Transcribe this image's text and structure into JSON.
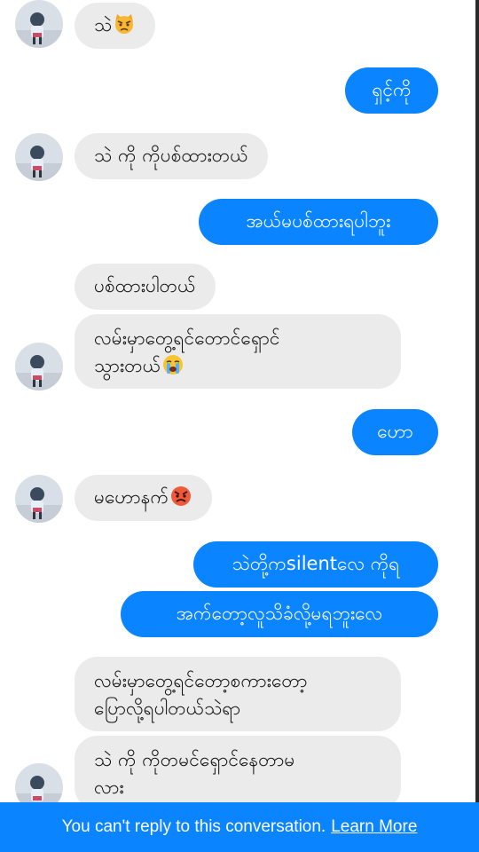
{
  "thread": {
    "messages": [
      {
        "text": "သဲ",
        "emoji": "pouting-cat-emoji"
      },
      {
        "text": "ရှင့်ကို"
      },
      {
        "text": "သဲ ကို ကိုပစ်ထားတယ်"
      },
      {
        "text": "အယ်မပစ်ထားရပါဘူး"
      },
      {
        "text": "ပစ်ထားပါတယ်"
      },
      {
        "line1": "လမ်းမှာတွေ့ရင်တောင်ရှောင်",
        "line2": "သွားတယ်",
        "emoji": "crying-face-emoji"
      },
      {
        "text": "ဟော"
      },
      {
        "text": "မဟောနက်",
        "emoji": "angry-face-emoji"
      },
      {
        "text": "သဲတို့ကsilentလေ ကိုရ"
      },
      {
        "text": "အက်တော့လူသိခံလို့မရဘူးလေ"
      },
      {
        "line1": "လမ်းမှာတွေ့ရင်တော့စကားတော့",
        "line2": "ပြောလို့ရပါတယ်သဲရာ"
      },
      {
        "line1": "သဲ ကို ကိုတမင်ရှောင်နေတာမ",
        "line2": "လား"
      }
    ]
  },
  "footer": {
    "notice": "You can't reply to this conversation.",
    "link": "Learn More"
  },
  "colors": {
    "outgoing_bubble": "#0a84ff",
    "incoming_bubble": "#ebebeb",
    "footer_bar": "#0a84ff"
  },
  "icons": {
    "avatar": "profile-photo",
    "emojis": [
      "pouting-cat-emoji",
      "crying-face-emoji",
      "angry-face-emoji"
    ]
  }
}
